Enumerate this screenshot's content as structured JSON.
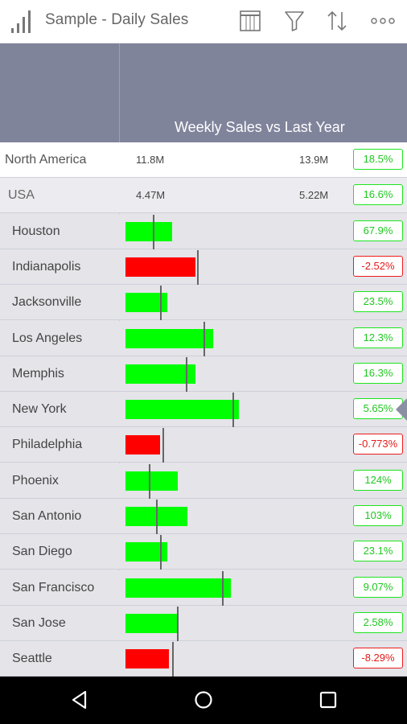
{
  "app": {
    "title": "Sample - Daily Sales",
    "icons": [
      "chart-signal-icon",
      "columns-icon",
      "filter-icon",
      "sort-icon",
      "more-icon"
    ]
  },
  "header": {
    "caption": "Weekly Sales vs Last Year"
  },
  "rows": [
    {
      "kind": "total",
      "name": "North America",
      "v1": "11.8M",
      "v2": "13.9M",
      "change": "18.5%",
      "positive": true
    },
    {
      "kind": "sub",
      "name": "USA",
      "v1": "4.47M",
      "v2": "5.22M",
      "change": "16.6%",
      "positive": true
    },
    {
      "kind": "city",
      "name": "Houston",
      "change": "67.9%",
      "positive": true,
      "value": 0.207,
      "target": 0.123
    },
    {
      "kind": "city",
      "name": "Indianapolis",
      "change": "-2.52%",
      "positive": false,
      "value": 0.313,
      "target": 0.321
    },
    {
      "kind": "city",
      "name": "Jacksonville",
      "change": "23.5%",
      "positive": true,
      "value": 0.188,
      "target": 0.153
    },
    {
      "kind": "city",
      "name": "Los Angeles",
      "change": "12.3%",
      "positive": true,
      "value": 0.393,
      "target": 0.35
    },
    {
      "kind": "city",
      "name": "Memphis",
      "change": "16.3%",
      "positive": true,
      "value": 0.313,
      "target": 0.27
    },
    {
      "kind": "city",
      "name": "New York",
      "change": "5.65%",
      "positive": true,
      "value": 0.506,
      "target": 0.479
    },
    {
      "kind": "city",
      "name": "Philadelphia",
      "change": "-0.773%",
      "positive": false,
      "value": 0.156,
      "target": 0.164
    },
    {
      "kind": "city",
      "name": "Phoenix",
      "change": "124%",
      "positive": true,
      "value": 0.235,
      "target": 0.105
    },
    {
      "kind": "city",
      "name": "San Antonio",
      "change": "103%",
      "positive": true,
      "value": 0.276,
      "target": 0.136
    },
    {
      "kind": "city",
      "name": "San Diego",
      "change": "23.1%",
      "positive": true,
      "value": 0.188,
      "target": 0.153
    },
    {
      "kind": "city",
      "name": "San Francisco",
      "change": "9.07%",
      "positive": true,
      "value": 0.47,
      "target": 0.431
    },
    {
      "kind": "city",
      "name": "San Jose",
      "change": "2.58%",
      "positive": true,
      "value": 0.237,
      "target": 0.231
    },
    {
      "kind": "city",
      "name": "Seattle",
      "change": "-8.29%",
      "positive": false,
      "value": 0.193,
      "target": 0.21
    }
  ],
  "selected_row": "New York",
  "colors": {
    "positive": "#00ff00",
    "negative": "#ff0000",
    "header": "#80849b"
  },
  "navbar": {
    "icons": [
      "back-icon",
      "home-icon",
      "recents-icon"
    ]
  }
}
